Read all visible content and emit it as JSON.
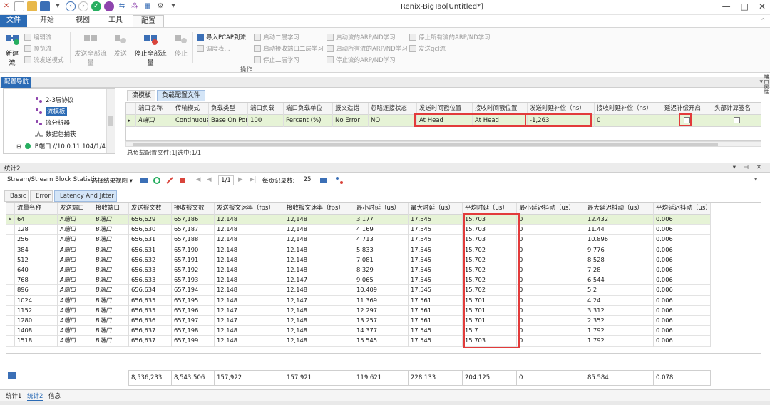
{
  "window": {
    "title": "Renix-BigTao[Untitled*]",
    "controls": [
      "—",
      "□",
      "✕"
    ]
  },
  "ribbon": {
    "tabs": [
      "文件",
      "开始",
      "视图",
      "工具",
      "配置"
    ],
    "active_tab": "配置",
    "new_flow": "新建流",
    "edit_flow": "编辑流",
    "preview_flow": "预览流",
    "flow_send_mode": "流发送模式",
    "send_all": "发送全部流量",
    "send": "发送",
    "stop_all": "停止全部流量",
    "stop": "停止",
    "import_pcap": "导入PCAP到流",
    "schedule": "调度表...",
    "start_l2": "启动二层学习",
    "start_rx_port_l2": "启动接收端口二层学习",
    "stop_l2": "停止二层学习",
    "start_arp_nd": "启动流的ARP/ND学习",
    "start_all_arp_nd": "启动所有流的ARP/ND学习",
    "stop_arp_nd": "停止流的ARP/ND学习",
    "stop_all_arp_nd": "停止所有流的ARP/ND学习",
    "send_qcl": "发送qcl流",
    "group_label": "操作"
  },
  "nav": {
    "title": "配置导航",
    "side_label": "端口属性",
    "tree": [
      {
        "label": "2-3层协议"
      },
      {
        "label": "流模板"
      },
      {
        "label": "流分析器"
      },
      {
        "label": "数据包捕获"
      },
      {
        "label": "B端口 //10.0.11.104/1/4"
      }
    ]
  },
  "load_config": {
    "tabs": [
      "流模板",
      "负载配置文件"
    ],
    "active_tab": "负载配置文件",
    "headers": [
      "端口名称",
      "传输模式",
      "负载类型",
      "端口负载",
      "端口负载单位",
      "报文造错",
      "忽略连接状态",
      "发送时间戳位置",
      "接收时间戳位置",
      "发送时延补偿（ns）",
      "接收时延补偿（ns）",
      "延迟补偿开启",
      "头部计算签名"
    ],
    "row": [
      "A端口",
      "Continuous",
      "Base On Port",
      "100",
      "Percent (%)",
      "No Error",
      "NO",
      "At Head",
      "At Head",
      "-1,263",
      "0",
      "",
      ""
    ],
    "status": "总负载配置文件:1|选中:1/1"
  },
  "stats": {
    "title": "统计2",
    "panel_controls": "▾ ⊣ ✕",
    "view_name": "Stream/Stream Block Statistic",
    "view_select": "选择结果视图",
    "page": "1/1",
    "per_page_label": "每页记录数:",
    "per_page": "25",
    "subtabs": [
      "Basic",
      "Error",
      "Latency And Jitter"
    ],
    "active_subtab": "Latency And Jitter",
    "headers": [
      "流量名称",
      "发送端口",
      "接收端口",
      "发送报文数",
      "接收报文数",
      "发送报文速率（fps）",
      "接收报文速率（fps）",
      "最小时延（us）",
      "最大时延（us）",
      "平均时延（us）",
      "最小延迟抖动（us）",
      "最大延迟抖动（us）",
      "平均延迟抖动（us）"
    ],
    "rows": [
      [
        "64",
        "A端口",
        "B端口",
        "656,629",
        "657,186",
        "12,148",
        "12,148",
        "3.177",
        "17.545",
        "15.703",
        "0",
        "12.432",
        "0.006"
      ],
      [
        "128",
        "A端口",
        "B端口",
        "656,630",
        "657,187",
        "12,148",
        "12,148",
        "4.169",
        "17.545",
        "15.703",
        "0",
        "11.44",
        "0.006"
      ],
      [
        "256",
        "A端口",
        "B端口",
        "656,631",
        "657,188",
        "12,148",
        "12,148",
        "4.713",
        "17.545",
        "15.703",
        "0",
        "10.896",
        "0.006"
      ],
      [
        "384",
        "A端口",
        "B端口",
        "656,631",
        "657,190",
        "12,148",
        "12,148",
        "5.833",
        "17.545",
        "15.702",
        "0",
        "9.776",
        "0.006"
      ],
      [
        "512",
        "A端口",
        "B端口",
        "656,632",
        "657,191",
        "12,148",
        "12,148",
        "7.081",
        "17.545",
        "15.702",
        "0",
        "8.528",
        "0.006"
      ],
      [
        "640",
        "A端口",
        "B端口",
        "656,633",
        "657,192",
        "12,148",
        "12,148",
        "8.329",
        "17.545",
        "15.702",
        "0",
        "7.28",
        "0.006"
      ],
      [
        "768",
        "A端口",
        "B端口",
        "656,633",
        "657,193",
        "12,148",
        "12,147",
        "9.065",
        "17.545",
        "15.702",
        "0",
        "6.544",
        "0.006"
      ],
      [
        "896",
        "A端口",
        "B端口",
        "656,634",
        "657,194",
        "12,148",
        "12,148",
        "10.409",
        "17.545",
        "15.702",
        "0",
        "5.2",
        "0.006"
      ],
      [
        "1024",
        "A端口",
        "B端口",
        "656,635",
        "657,195",
        "12,148",
        "12,147",
        "11.369",
        "17.561",
        "15.701",
        "0",
        "4.24",
        "0.006"
      ],
      [
        "1152",
        "A端口",
        "B端口",
        "656,635",
        "657,196",
        "12,147",
        "12,148",
        "12.297",
        "17.561",
        "15.701",
        "0",
        "3.312",
        "0.006"
      ],
      [
        "1280",
        "A端口",
        "B端口",
        "656,636",
        "657,197",
        "12,147",
        "12,148",
        "13.257",
        "17.561",
        "15.701",
        "0",
        "2.352",
        "0.006"
      ],
      [
        "1408",
        "A端口",
        "B端口",
        "656,637",
        "657,198",
        "12,148",
        "12,148",
        "14.377",
        "17.545",
        "15.7",
        "0",
        "1.792",
        "0.006"
      ],
      [
        "1518",
        "A端口",
        "B端口",
        "656,637",
        "657,199",
        "12,148",
        "12,148",
        "15.545",
        "17.545",
        "15.703",
        "0",
        "1.792",
        "0.006"
      ]
    ],
    "totals": [
      "8,536,233",
      "8,543,506",
      "157,922",
      "157,921",
      "119.621",
      "228.133",
      "204.125",
      "0",
      "85.584",
      "0.078"
    ]
  },
  "bottom_tabs": [
    "统计1",
    "统计2",
    "信息"
  ],
  "bottom_active": "统计2",
  "colors": {
    "accent": "#2b6bb5",
    "selected_row": "#e6f3d6",
    "highlight_box": "#e23b3b"
  }
}
